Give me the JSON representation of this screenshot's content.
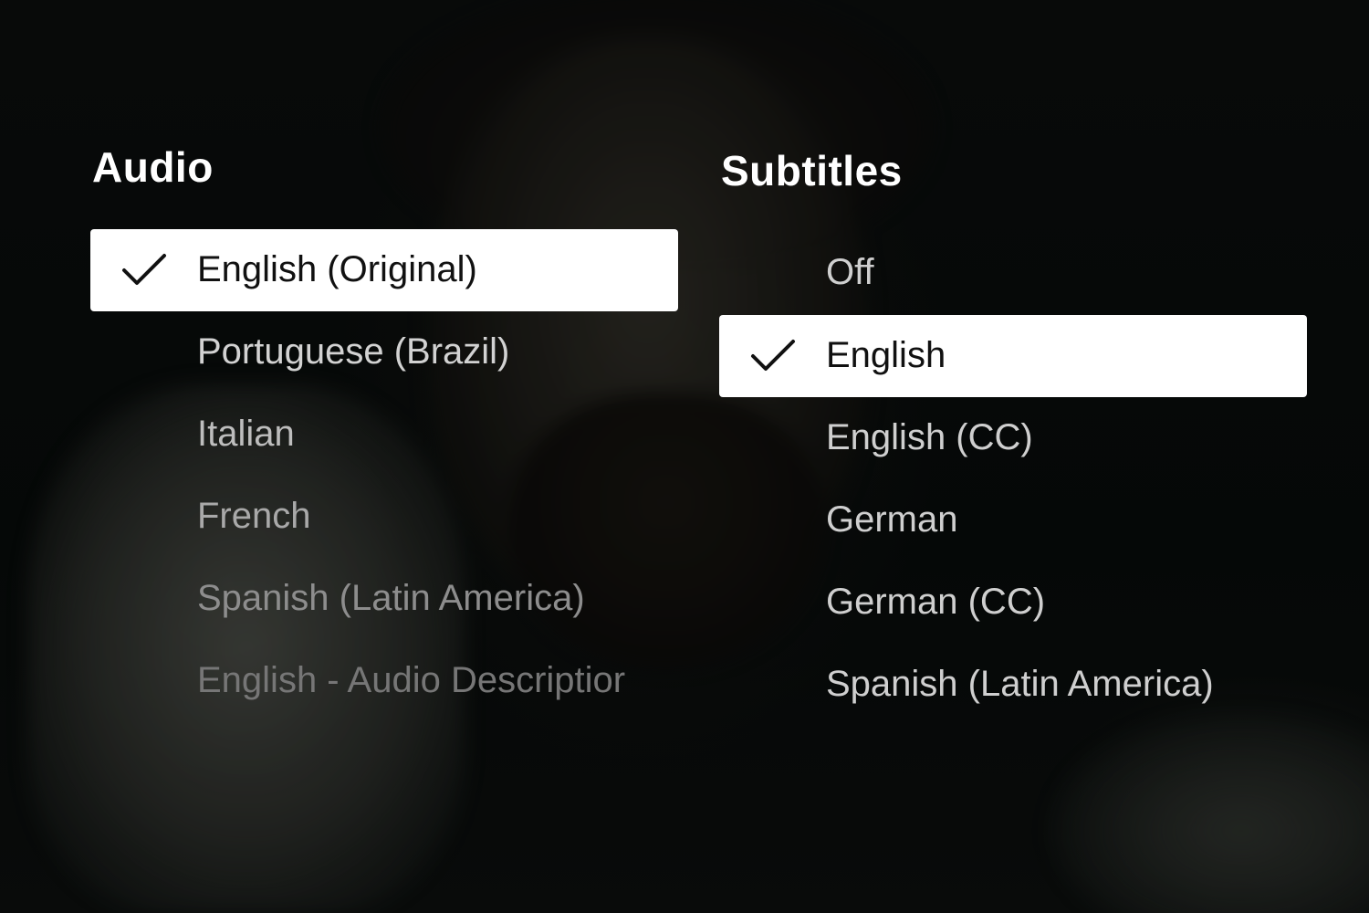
{
  "audio": {
    "title": "Audio",
    "options": [
      {
        "label": "English (Original)",
        "selected": true
      },
      {
        "label": "Portuguese (Brazil)",
        "selected": false
      },
      {
        "label": "Italian",
        "selected": false
      },
      {
        "label": "French",
        "selected": false
      },
      {
        "label": "Spanish (Latin America)",
        "selected": false
      },
      {
        "label": "English - Audio Descriptior",
        "selected": false
      }
    ]
  },
  "subtitles": {
    "title": "Subtitles",
    "options": [
      {
        "label": "Off",
        "selected": false
      },
      {
        "label": "English",
        "selected": true
      },
      {
        "label": "English (CC)",
        "selected": false
      },
      {
        "label": "German",
        "selected": false
      },
      {
        "label": "German (CC)",
        "selected": false
      },
      {
        "label": "Spanish (Latin America)",
        "selected": false
      }
    ]
  },
  "icons": {
    "selected_marker": "checkmark-icon"
  },
  "colors": {
    "selected_background": "#ffffff",
    "selected_text": "#111111",
    "title_text": "#ffffff"
  }
}
